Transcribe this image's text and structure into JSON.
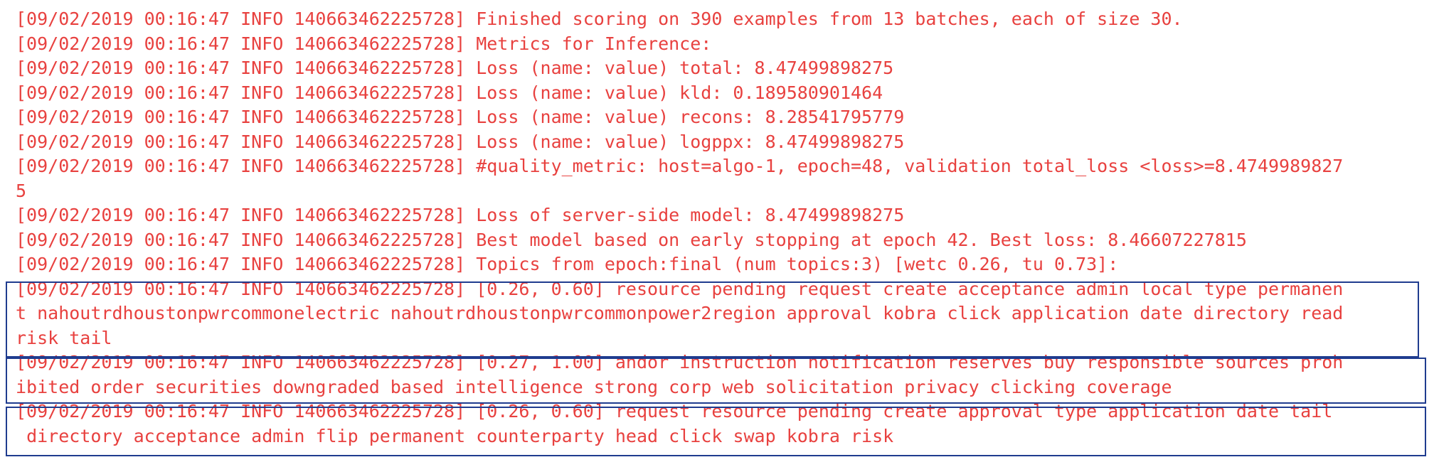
{
  "log": {
    "color": "#e8413f",
    "lines": [
      "[09/02/2019 00:16:47 INFO 140663462225728] Finished scoring on 390 examples from 13 batches, each of size 30.",
      "[09/02/2019 00:16:47 INFO 140663462225728] Metrics for Inference:",
      "[09/02/2019 00:16:47 INFO 140663462225728] Loss (name: value) total: 8.47499898275",
      "[09/02/2019 00:16:47 INFO 140663462225728] Loss (name: value) kld: 0.189580901464",
      "[09/02/2019 00:16:47 INFO 140663462225728] Loss (name: value) recons: 8.28541795779",
      "[09/02/2019 00:16:47 INFO 140663462225728] Loss (name: value) logppx: 8.47499898275",
      "[09/02/2019 00:16:47 INFO 140663462225728] #quality_metric: host=algo-1, epoch=48, validation total_loss <loss>=8.4749989827\n5",
      "[09/02/2019 00:16:47 INFO 140663462225728] Loss of server-side model: 8.47499898275",
      "[09/02/2019 00:16:47 INFO 140663462225728] Best model based on early stopping at epoch 42. Best loss: 8.46607227815",
      "[09/02/2019 00:16:47 INFO 140663462225728] Topics from epoch:final (num topics:3) [wetc 0.26, tu 0.73]:",
      "[09/02/2019 00:16:47 INFO 140663462225728] [0.26, 0.60] resource pending request create acceptance admin local type permanen\nt nahoutrdhoustonpwrcommonelectric nahoutrdhoustonpwrcommonpower2region approval kobra click application date directory read\nrisk tail",
      "[09/02/2019 00:16:47 INFO 140663462225728] [0.27, 1.00] andor instruction notification reserves buy responsible sources proh\nibited order securities downgraded based intelligence strong corp web solicitation privacy clicking coverage",
      "[09/02/2019 00:16:47 INFO 140663462225728] [0.26, 0.60] request resource pending create approval type application date tail\n directory acceptance admin flip permanent counterparty head click swap kobra risk"
    ]
  },
  "highlight": {
    "border_color": "#1f3c8f"
  }
}
